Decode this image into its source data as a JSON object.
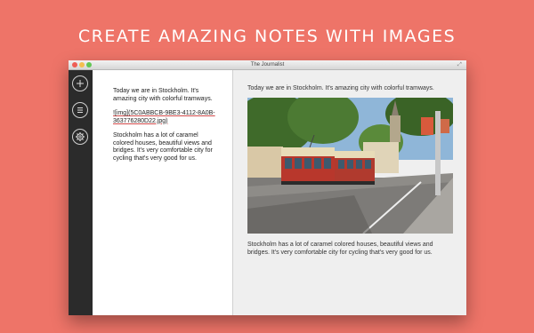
{
  "headline": "CREATE AMAZING NOTES WITH IMAGES",
  "window": {
    "title": "The Journalist"
  },
  "sidebar": {
    "buttons": [
      {
        "name": "add-note-button",
        "icon": "plus-icon"
      },
      {
        "name": "notes-list-button",
        "icon": "list-icon"
      },
      {
        "name": "settings-button",
        "icon": "gear-icon"
      }
    ]
  },
  "editor": {
    "paragraph1": "Today we are in Stockholm. It's amazing city with colorful tramways.",
    "image_tag": "![img](5C0ABBCB-9BE3-4112-8A0B-363776280D22.jpg)",
    "paragraph2": "Stockholm has a lot of caramel colored houses, beautiful views and bridges. It's very comfortable city for cycling that's very good for us."
  },
  "preview": {
    "paragraph1": "Today we are in Stockholm. It's amazing city with colorful tramways.",
    "image_description_icon": "photo-tram-stockholm",
    "paragraph2": "Stockholm has a lot of caramel colored houses, beautiful views and bridges. It's very comfortable city for cycling that's very good for us."
  },
  "colors": {
    "background": "#ee7468",
    "sidebar": "#2b2b2b",
    "preview_bg": "#efefef",
    "tram_red": "#b8372c",
    "tram_cream": "#e8dcb8"
  }
}
